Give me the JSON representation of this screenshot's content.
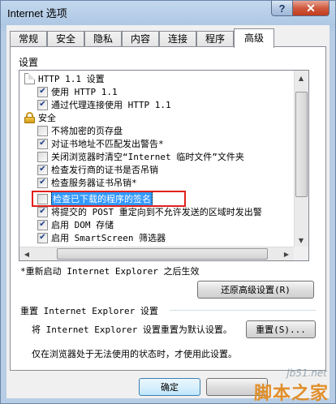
{
  "window": {
    "title": "Internet 选项",
    "help_glyph": "?",
    "close_glyph": "✕"
  },
  "tabs": [
    {
      "label": "常规"
    },
    {
      "label": "安全"
    },
    {
      "label": "隐私"
    },
    {
      "label": "内容"
    },
    {
      "label": "连接"
    },
    {
      "label": "程序"
    },
    {
      "label": "高级",
      "active": true
    }
  ],
  "settings": {
    "label": "设置",
    "items": [
      {
        "type": "folder",
        "text": "HTTP 1.1 设置"
      },
      {
        "type": "checkbox",
        "checked": true,
        "text": "使用 HTTP 1.1"
      },
      {
        "type": "checkbox",
        "checked": true,
        "text": "通过代理连接使用 HTTP 1.1"
      },
      {
        "type": "lock",
        "text": "安全"
      },
      {
        "type": "checkbox",
        "checked": false,
        "text": "不将加密的页存盘"
      },
      {
        "type": "checkbox",
        "checked": true,
        "text": "对证书地址不匹配发出警告*"
      },
      {
        "type": "checkbox",
        "checked": false,
        "text": "关闭浏览器时清空“Internet 临时文件”文件夹"
      },
      {
        "type": "checkbox",
        "checked": true,
        "text": "检查发行商的证书是否吊销"
      },
      {
        "type": "checkbox",
        "checked": true,
        "text": "检查服务器证书吊销*"
      },
      {
        "type": "checkbox",
        "checked": false,
        "text": "检查已下载的程序的签名",
        "selected": true
      },
      {
        "type": "checkbox",
        "checked": true,
        "text": "将提交的 POST 重定向到不允许发送的区域时发出警"
      },
      {
        "type": "checkbox",
        "checked": true,
        "text": "启用 DOM 存储"
      },
      {
        "type": "checkbox",
        "checked": true,
        "text": "启用 SmartScreen 筛选器"
      }
    ],
    "check_glyph": "✔"
  },
  "restart_note": "*重新启动 Internet Explorer 之后生效",
  "restore_advanced_button": "还原高级设置(R)",
  "reset": {
    "title": "重置 Internet Explorer 设置",
    "description": "将 Internet Explorer 设置重置为默认设置。",
    "button": "重置(S)...",
    "note": "仅在浏览器处于无法使用的状态时，才使用此设置。"
  },
  "footer": {
    "ok_button": "确定"
  },
  "watermark": {
    "url": "jb51.net",
    "brand": "脚本之家"
  },
  "colors": {
    "selection": "#3399ff",
    "highlight_box": "#e0201b",
    "close_button": "#c23b1d"
  }
}
